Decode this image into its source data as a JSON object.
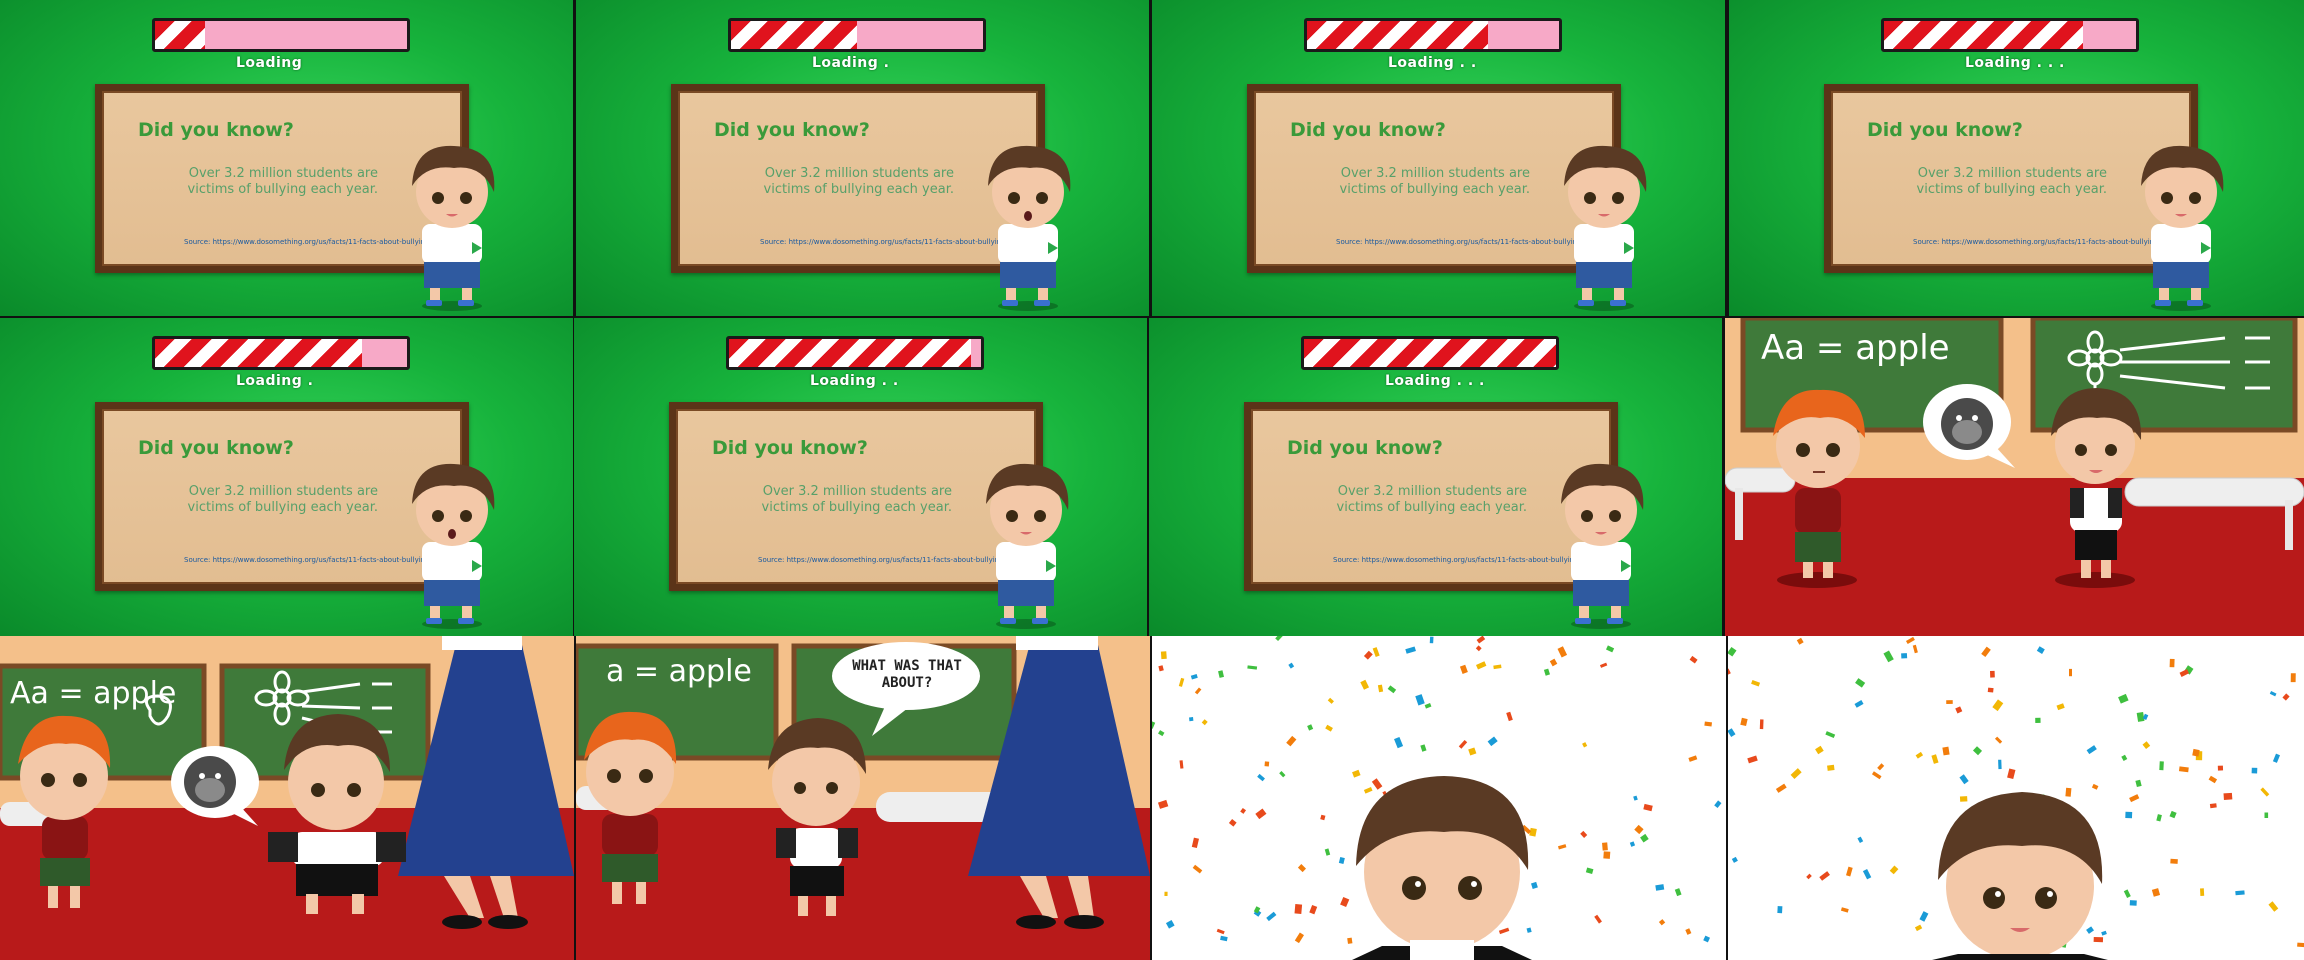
{
  "loading_screens": [
    {
      "label": "Loading",
      "progress": 0.2
    },
    {
      "label": "Loading .",
      "progress": 0.5
    },
    {
      "label": "Loading . .",
      "progress": 0.72
    },
    {
      "label": "Loading . . .",
      "progress": 0.79
    },
    {
      "label": "Loading .",
      "progress": 0.82
    },
    {
      "label": "Loading . .",
      "progress": 0.96
    },
    {
      "label": "Loading . . .",
      "progress": 1.0
    }
  ],
  "fact_card": {
    "title": "Did you know?",
    "line1": "Over 3.2 million students are",
    "line2": "victims of bullying each year.",
    "source": "Source: https://www.dosomething.org/us/facts/11-facts-about-bullying"
  },
  "classroom": {
    "board_text_1": "Aa = apple",
    "board_text_1_alt": "a = apple",
    "speech_bubble": "WHAT WAS THAT ABOUT?"
  },
  "colors": {
    "loading_green": "#17b33c",
    "bar_red": "#e0131d",
    "bar_pink": "#f7a9c7",
    "board_brown": "#5b3418",
    "floor_red": "#b01818",
    "chalkboard_green": "#3f7a3a"
  }
}
